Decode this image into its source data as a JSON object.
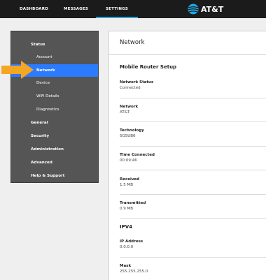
{
  "nav": {
    "tabs": [
      {
        "label": "DASHBOARD"
      },
      {
        "label": "MESSAGES"
      },
      {
        "label": "SETTINGS"
      }
    ],
    "logo_text": "AT&T"
  },
  "sidebar": {
    "items": [
      {
        "label": "Status"
      },
      {
        "label": "Account"
      },
      {
        "label": "Network"
      },
      {
        "label": "Device"
      },
      {
        "label": "WiFi Details"
      },
      {
        "label": "Diagnostics"
      },
      {
        "label": "General"
      },
      {
        "label": "Security"
      },
      {
        "label": "Administration"
      },
      {
        "label": "Advanced"
      },
      {
        "label": "Help & Support"
      }
    ],
    "active": "Network"
  },
  "main": {
    "title": "Network",
    "section1": "Mobile Router Setup",
    "fields": [
      {
        "label": "Network Status",
        "value": "Connected"
      },
      {
        "label": "Network",
        "value": "AT&T"
      },
      {
        "label": "Technology",
        "value": "5GSUB6"
      },
      {
        "label": "Time Connected",
        "value": "00:09:46"
      },
      {
        "label": "Received",
        "value": "1.5 MB"
      },
      {
        "label": "Transmitted",
        "value": "0.9 MB"
      }
    ],
    "section2": "IPV4",
    "ipv4_fields": [
      {
        "label": "IP Address",
        "value": "0.0.0.0"
      },
      {
        "label": "Mask",
        "value": "255.255.255.0"
      }
    ]
  },
  "colors": {
    "topbar": "#1b1b1b",
    "sidebar": "#555555",
    "active": "#2b7bff",
    "arrow": "#f5a623",
    "tab_underline": "#1ea7e1"
  }
}
